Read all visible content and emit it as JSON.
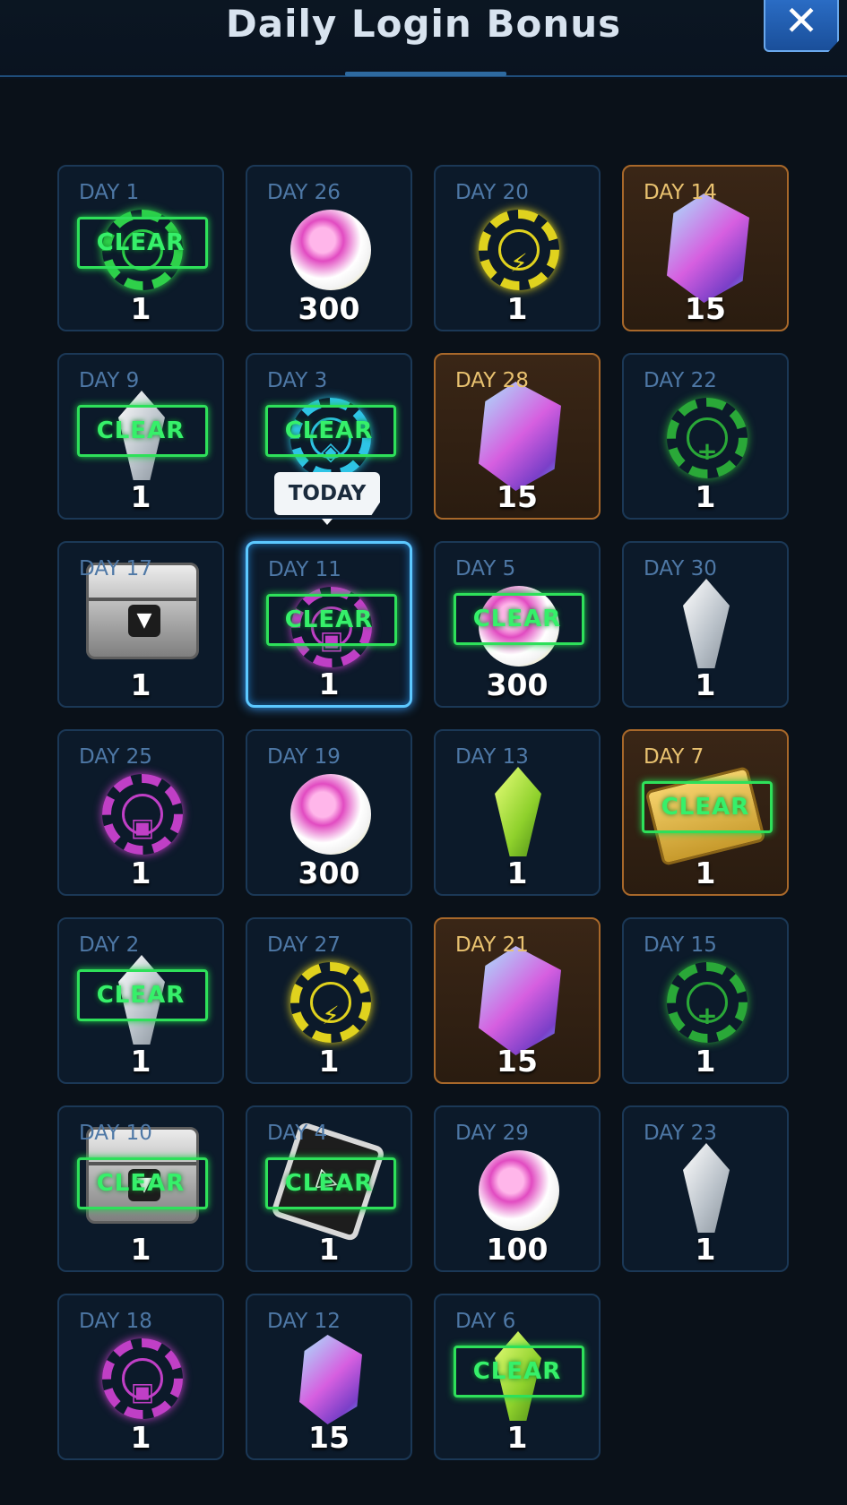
{
  "header": {
    "title": "Daily Login Bonus",
    "close_label": "✕"
  },
  "today_label": "TODAY",
  "clear_label": "CLEAR",
  "accent_colors": {
    "clear": "#36f06a",
    "today": "#5cc8ff",
    "gold": "#e9c270"
  },
  "cells": [
    {
      "day": "DAY 1",
      "qty": "1",
      "item": "green-chip-icon",
      "cleared": true
    },
    {
      "day": "DAY 9",
      "qty": "1",
      "item": "white-crystal-icon",
      "cleared": true
    },
    {
      "day": "DAY 17",
      "qty": "1",
      "item": "silver-chest-icon",
      "cleared": false
    },
    {
      "day": "DAY 25",
      "qty": "1",
      "item": "purple-chip-icon",
      "cleared": false
    },
    {
      "day": "DAY 2",
      "qty": "1",
      "item": "white-crystal-icon",
      "cleared": true
    },
    {
      "day": "DAY 10",
      "qty": "1",
      "item": "silver-chest-icon",
      "cleared": true
    },
    {
      "day": "DAY 18",
      "qty": "1",
      "item": "purple-chip-icon",
      "cleared": false
    },
    {
      "day": "DAY 26",
      "qty": "300",
      "item": "pink-orb-icon",
      "cleared": false
    },
    {
      "day": "DAY 3",
      "qty": "1",
      "item": "cyan-chip-icon",
      "cleared": true
    },
    {
      "day": "DAY 11",
      "qty": "1",
      "item": "purple-chip-icon",
      "cleared": true,
      "today": true
    },
    {
      "day": "DAY 19",
      "qty": "300",
      "item": "pink-orb-icon",
      "cleared": false
    },
    {
      "day": "DAY 27",
      "qty": "1",
      "item": "yellow-energy-chip-icon",
      "cleared": false
    },
    {
      "day": "DAY 4",
      "qty": "1",
      "item": "play-card-icon",
      "cleared": true
    },
    {
      "day": "DAY 12",
      "qty": "15",
      "item": "prism-gem-icon",
      "cleared": false
    },
    {
      "day": "DAY 20",
      "qty": "1",
      "item": "yellow-energy-chip-icon",
      "cleared": false
    },
    {
      "day": "DAY 28",
      "qty": "15",
      "item": "prism-gem-icon",
      "cleared": false,
      "gold": true
    },
    {
      "day": "DAY 5",
      "qty": "300",
      "item": "pink-orb-icon",
      "cleared": true
    },
    {
      "day": "DAY 13",
      "qty": "1",
      "item": "green-crystal-icon",
      "cleared": false
    },
    {
      "day": "DAY 21",
      "qty": "15",
      "item": "prism-gem-icon",
      "cleared": false,
      "gold": true
    },
    {
      "day": "DAY 29",
      "qty": "100",
      "item": "pink-orb-icon",
      "cleared": false
    },
    {
      "day": "DAY 6",
      "qty": "1",
      "item": "green-crystal-icon",
      "cleared": true
    },
    {
      "day": "DAY 14",
      "qty": "15",
      "item": "prism-gem-icon",
      "cleared": false,
      "gold": true
    },
    {
      "day": "DAY 22",
      "qty": "1",
      "item": "green-plus-chip-icon",
      "cleared": false
    },
    {
      "day": "DAY 30",
      "qty": "1",
      "item": "white-crystal-icon",
      "cleared": false
    },
    {
      "day": "DAY 7",
      "qty": "1",
      "item": "gold-ticket-icon",
      "cleared": true,
      "gold": true
    },
    {
      "day": "DAY 15",
      "qty": "1",
      "item": "green-plus-chip-icon",
      "cleared": false
    },
    {
      "day": "DAY 23",
      "qty": "1",
      "item": "white-crystal-icon",
      "cleared": false
    }
  ]
}
